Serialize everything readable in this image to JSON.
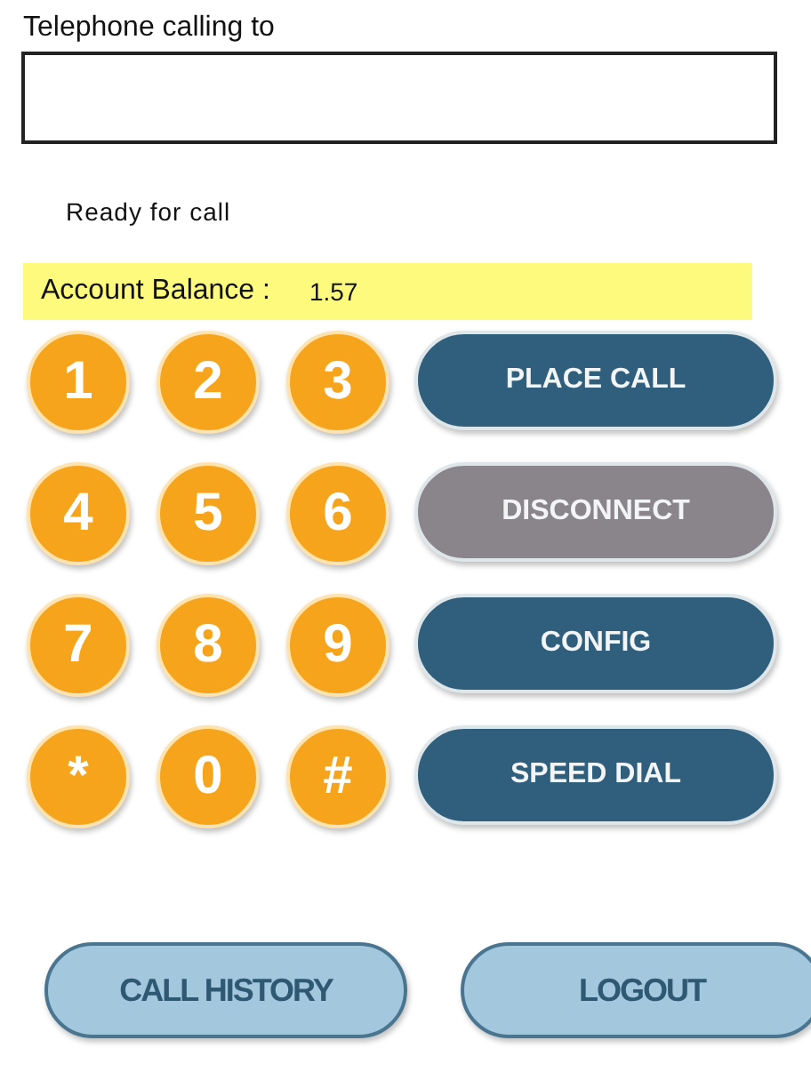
{
  "phone_field": {
    "label": "Telephone calling to"
  },
  "status": "Ready for call",
  "balance": {
    "label": "Account Balance :",
    "value": "1.57"
  },
  "keypad": [
    "1",
    "2",
    "3",
    "4",
    "5",
    "6",
    "7",
    "8",
    "9",
    "*",
    "0",
    "#"
  ],
  "action_buttons": [
    {
      "label": "PLACE CALL",
      "disabled": false
    },
    {
      "label": "DISCONNECT",
      "disabled": true
    },
    {
      "label": "CONFIG",
      "disabled": false
    },
    {
      "label": "SPEED DIAL",
      "disabled": false
    }
  ],
  "bottom_buttons": [
    "CALL HISTORY",
    "LOGOUT"
  ]
}
